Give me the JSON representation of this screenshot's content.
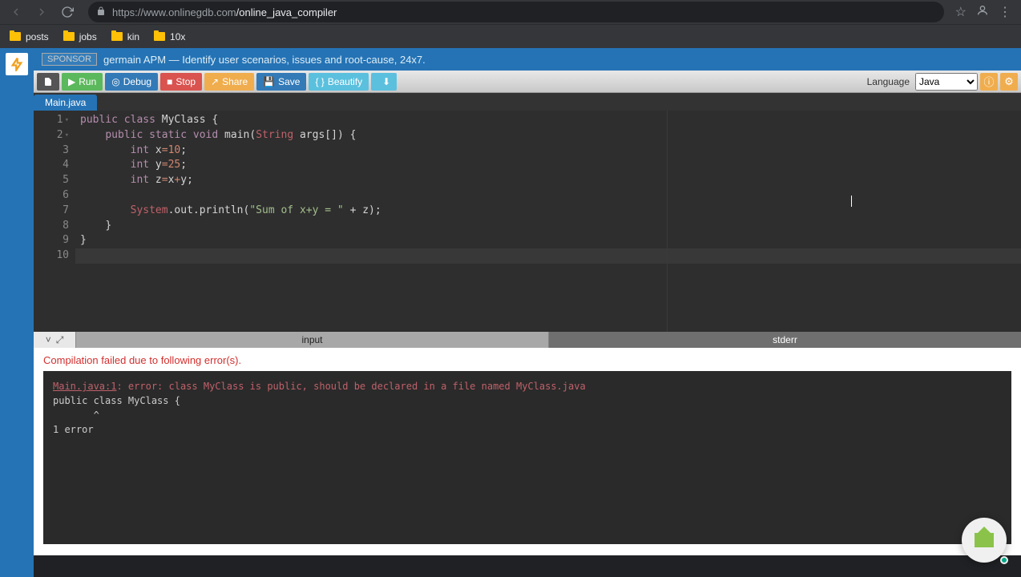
{
  "browser": {
    "url_host": "https://www.onlinegdb.com",
    "url_path": "/online_java_compiler"
  },
  "bookmarks": [
    "posts",
    "jobs",
    "kin",
    "10x"
  ],
  "sponsor": {
    "badge": "SPONSOR",
    "text": "germain APM — Identify user scenarios, issues and root-cause, 24x7."
  },
  "toolbar": {
    "run": "Run",
    "debug": "Debug",
    "stop": "Stop",
    "share": "Share",
    "save": "Save",
    "beautify": "Beautify",
    "lang_label": "Language",
    "lang_value": "Java"
  },
  "tab_name": "Main.java",
  "code_lines": [
    {
      "n": 1,
      "fold": true
    },
    {
      "n": 2,
      "fold": true
    },
    {
      "n": 3
    },
    {
      "n": 4
    },
    {
      "n": 5
    },
    {
      "n": 6
    },
    {
      "n": 7
    },
    {
      "n": 8
    },
    {
      "n": 9
    },
    {
      "n": 10
    }
  ],
  "code": {
    "l1_a": "public",
    "l1_b": "class",
    "l1_c": "MyClass",
    "l1_d": " {",
    "l2_pre": "    ",
    "l2_a": "public",
    "l2_b": "static",
    "l2_c": "void",
    "l2_d": "main",
    "l2_e": "(",
    "l2_f": "String",
    "l2_g": " args[]) {",
    "l3_pre": "        ",
    "l3_a": "int",
    "l3_b": " x",
    "l3_c": "=",
    "l3_d": "10",
    "l3_e": ";",
    "l4_pre": "        ",
    "l4_a": "int",
    "l4_b": " y",
    "l4_c": "=",
    "l4_d": "25",
    "l4_e": ";",
    "l5_pre": "        ",
    "l5_a": "int",
    "l5_b": " z",
    "l5_c": "=",
    "l5_d": "x",
    "l5_e": "+",
    "l5_f": "y",
    "l5_g": ";",
    "l6": "",
    "l7_pre": "        ",
    "l7_a": "System",
    "l7_b": ".out.println(",
    "l7_c": "\"Sum of x+y = \"",
    "l7_d": " + z);",
    "l8_pre": "    ",
    "l8_a": "}",
    "l9_a": "}"
  },
  "bottom_tabs": {
    "input": "input",
    "stderr": "stderr"
  },
  "output": {
    "header": "Compilation failed due to following error(s).",
    "loc": "Main.java:1",
    "loc_msg": ": error: class MyClass is public, should be declared in a file named MyClass.java",
    "line2": "public class MyClass {",
    "line3": "       ^",
    "line4": "1 error"
  }
}
